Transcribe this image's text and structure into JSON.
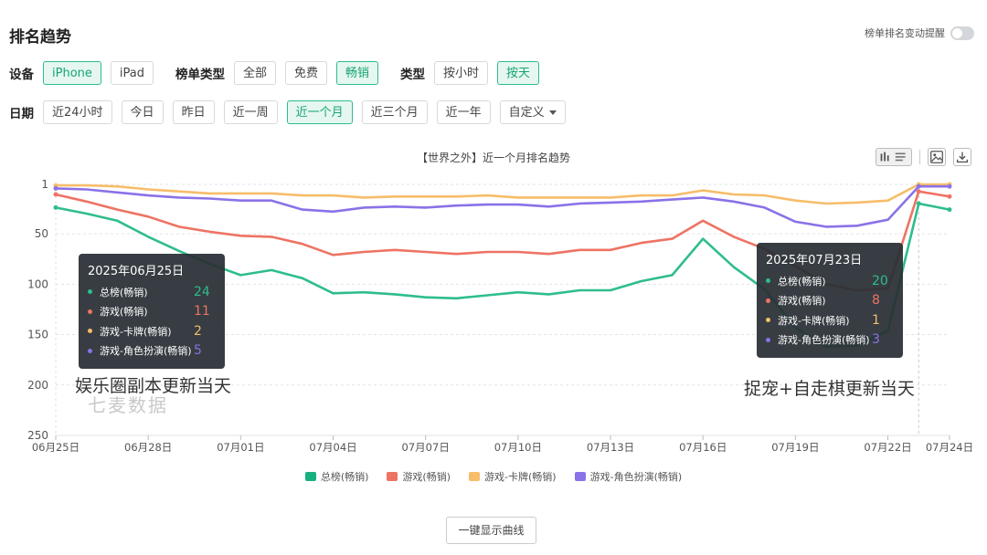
{
  "header": {
    "title": "排名趋势",
    "remind_label": "榜单排名变动提醒"
  },
  "filters": {
    "device": {
      "label": "设备",
      "options": [
        "iPhone",
        "iPad"
      ],
      "active": 0
    },
    "list_type": {
      "label": "榜单类型",
      "options": [
        "全部",
        "免费",
        "畅销"
      ],
      "active": 2
    },
    "type": {
      "label": "类型",
      "options": [
        "按小时",
        "按天"
      ],
      "active": 1
    },
    "date": {
      "label": "日期",
      "options": [
        "近24小时",
        "今日",
        "昨日",
        "近一周",
        "近一个月",
        "近三个月",
        "近一年",
        "自定义"
      ],
      "active": 4
    }
  },
  "toolbar": {
    "icons": [
      "chart-type-icon",
      "list-icon",
      "image-icon",
      "download-icon"
    ]
  },
  "chart_data": {
    "type": "line",
    "title": "【世界之外】近一个月排名趋势",
    "x": [
      "06月25日",
      "06月26日",
      "06月27日",
      "06月28日",
      "06月29日",
      "06月30日",
      "07月01日",
      "07月02日",
      "07月03日",
      "07月04日",
      "07月05日",
      "07月06日",
      "07月07日",
      "07月08日",
      "07月09日",
      "07月10日",
      "07月11日",
      "07月12日",
      "07月13日",
      "07月14日",
      "07月15日",
      "07月16日",
      "07月17日",
      "07月18日",
      "07月19日",
      "07月20日",
      "07月21日",
      "07月22日",
      "07月23日",
      "07月24日"
    ],
    "x_ticks": [
      "06月25日",
      "06月28日",
      "07月01日",
      "07月04日",
      "07月07日",
      "07月10日",
      "07月13日",
      "07月16日",
      "07月19日",
      "07月22日",
      "07月24日"
    ],
    "y_ticks": [
      1,
      50,
      100,
      150,
      200,
      250
    ],
    "ylim": [
      1,
      250
    ],
    "y_inverted": true,
    "grid": true,
    "legend_position": "bottom",
    "series": [
      {
        "name": "总榜(畅销)",
        "color": "#2ebd8d",
        "values": [
          24,
          30,
          37,
          53,
          67,
          80,
          91,
          86,
          94,
          109,
          108,
          110,
          113,
          114,
          111,
          108,
          110,
          106,
          106,
          97,
          91,
          55,
          83,
          105,
          143,
          162,
          161,
          146,
          20,
          26
        ]
      },
      {
        "name": "游戏(畅销)",
        "color": "#ee7364",
        "values": [
          11,
          18,
          26,
          33,
          43,
          48,
          52,
          53,
          60,
          71,
          68,
          66,
          68,
          70,
          68,
          68,
          70,
          66,
          66,
          59,
          55,
          37,
          53,
          65,
          82,
          100,
          106,
          104,
          8,
          13
        ]
      },
      {
        "name": "游戏-卡牌(畅销)",
        "color": "#f7bd6a",
        "values": [
          2,
          2,
          3,
          6,
          8,
          10,
          10,
          10,
          12,
          12,
          14,
          13,
          13,
          13,
          12,
          14,
          14,
          14,
          14,
          12,
          12,
          7,
          11,
          12,
          17,
          20,
          19,
          17,
          1,
          1
        ]
      },
      {
        "name": "游戏-角色扮演(畅销)",
        "color": "#8a72e8",
        "values": [
          5,
          6,
          9,
          12,
          14,
          15,
          17,
          17,
          26,
          28,
          24,
          23,
          24,
          22,
          21,
          21,
          23,
          20,
          19,
          18,
          16,
          14,
          18,
          24,
          38,
          43,
          42,
          36,
          3,
          3
        ]
      }
    ]
  },
  "tooltips": [
    {
      "date": "2025年06月25日",
      "values": [
        24,
        11,
        2,
        5
      ]
    },
    {
      "date": "2025年07月23日",
      "values": [
        20,
        8,
        1,
        3
      ]
    }
  ],
  "annotations": {
    "left": "娱乐圈副本更新当天",
    "right": "捉宠+自走棋更新当天"
  },
  "watermark": "七麦数据",
  "show_all_label": "一键显示曲线"
}
